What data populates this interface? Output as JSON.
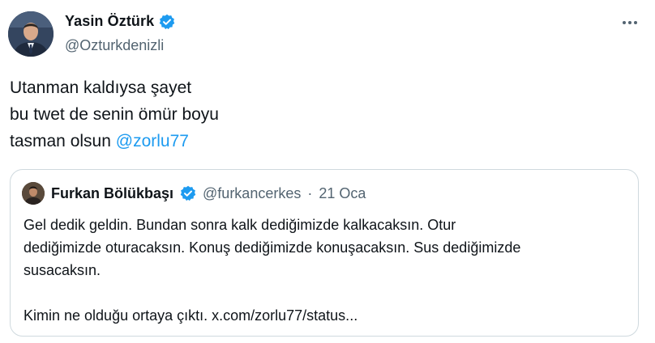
{
  "author": {
    "name": "Yasin Öztürk",
    "handle": "@Ozturkdenizli"
  },
  "tweet": {
    "lines": [
      "Utanman kaldıysa şayet",
      "bu twet de senin ömür boyu",
      "tasman olsun "
    ],
    "mention": "@zorlu77"
  },
  "quote": {
    "name": "Furkan Bölükbaşı",
    "handle": "@furkancerkes",
    "separator": "·",
    "date": "21 Oca",
    "lines": [
      "Gel dedik geldin. Bundan sonra kalk dediğimizde kalkacaksın. Otur",
      "dediğimizde oturacaksın. Konuş dediğimizde konuşacaksın. Sus dediğimizde",
      "susacaksın."
    ],
    "last_line": "Kimin ne olduğu ortaya çıktı. x.com/zorlu77/status..."
  },
  "colors": {
    "accent": "#1d9bf0",
    "text": "#0f1419",
    "secondary": "#536471",
    "border": "#cfd9de"
  },
  "icons": {
    "verified": "verified-badge-icon",
    "more": "more-options-icon"
  }
}
